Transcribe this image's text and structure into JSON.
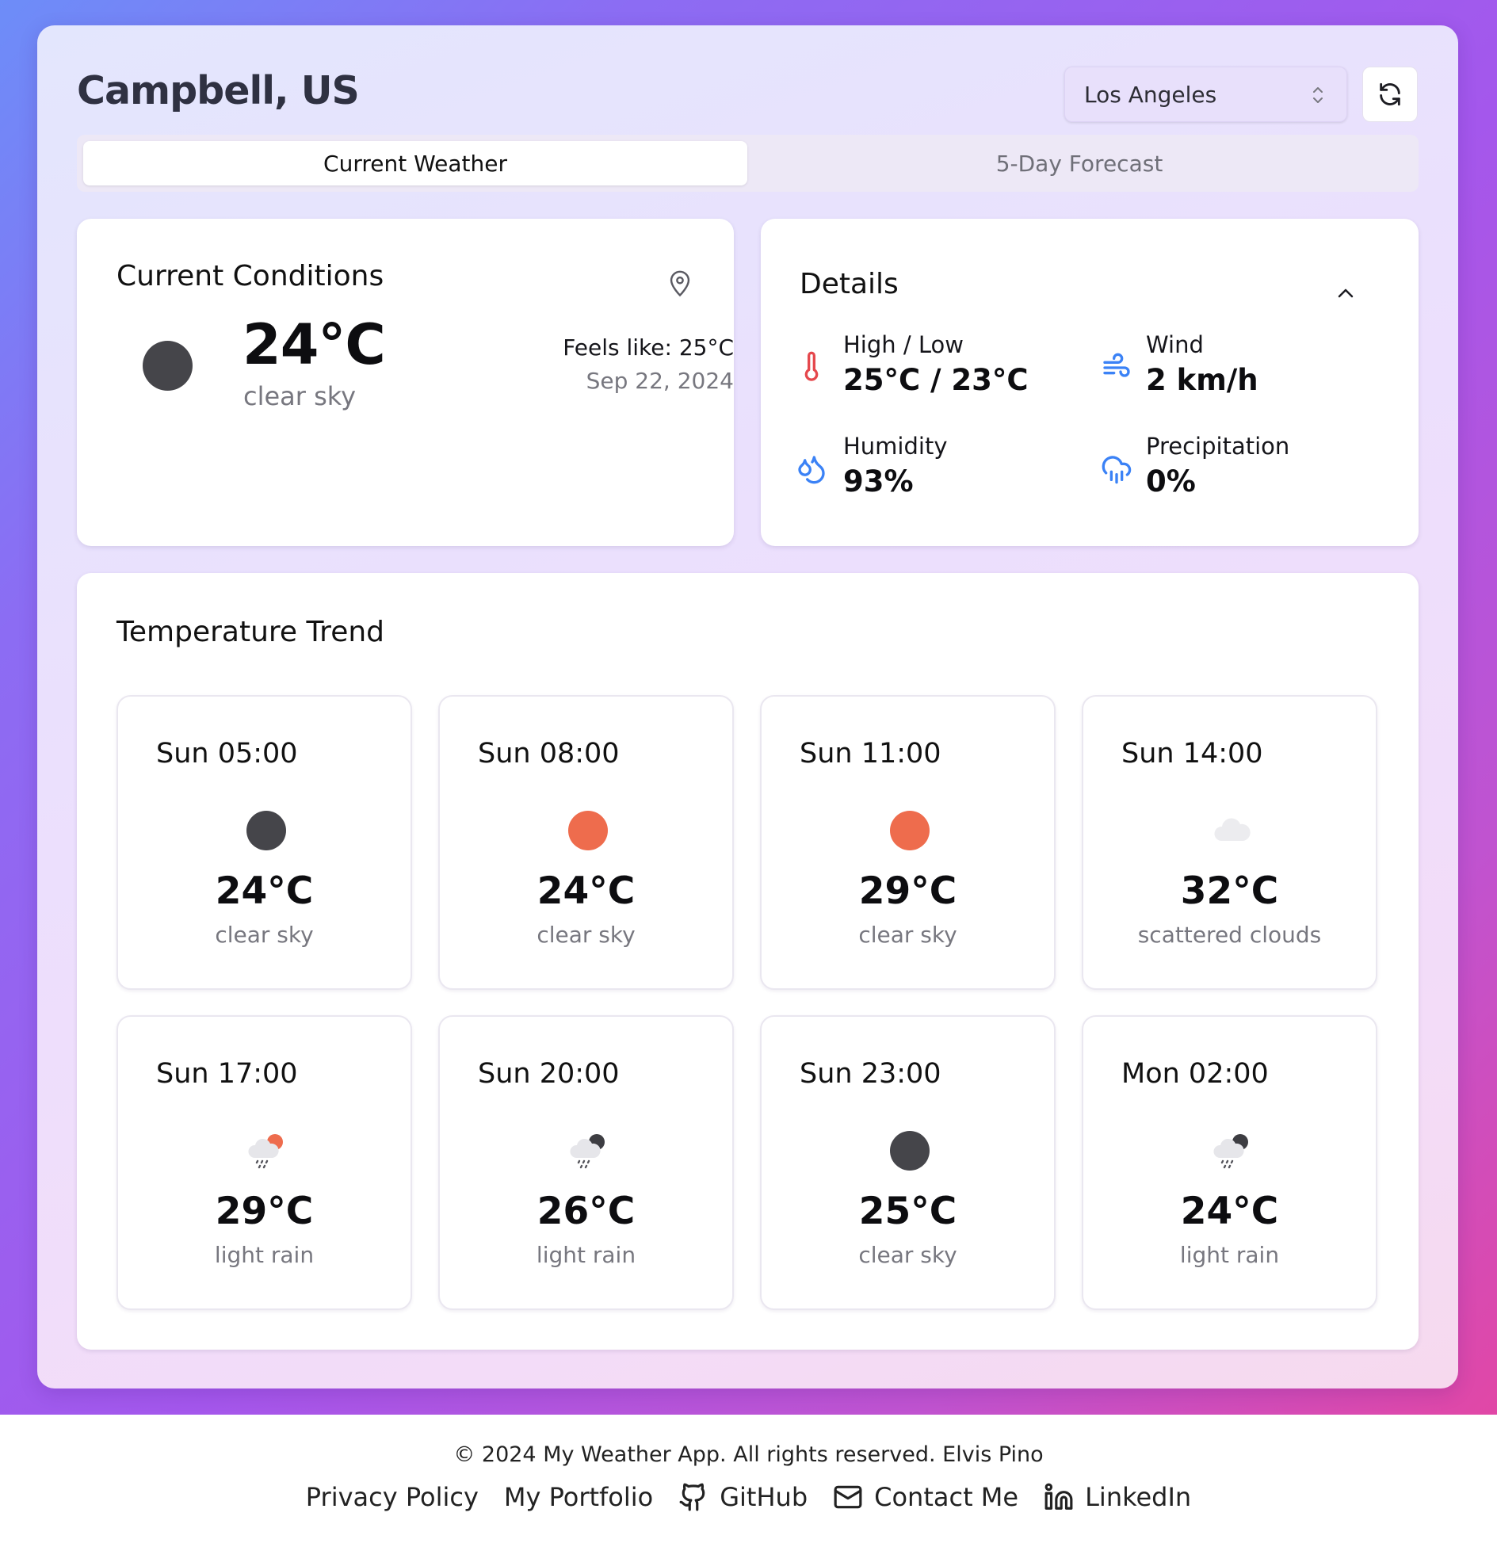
{
  "header": {
    "city_title": "Campbell, US",
    "city_select_value": "Los Angeles"
  },
  "tabs": [
    {
      "label": "Current Weather",
      "active": true
    },
    {
      "label": "5-Day Forecast",
      "active": false
    }
  ],
  "current": {
    "title": "Current Conditions",
    "temp": "24°C",
    "description": "clear sky",
    "feels_like": "Feels like: 25°C",
    "date": "Sep 22, 2024",
    "icon": "moon-icon"
  },
  "details": {
    "title": "Details",
    "items": [
      {
        "label": "High / Low",
        "value": "25°C / 23°C",
        "icon": "thermometer-icon",
        "color": "#e5484d"
      },
      {
        "label": "Wind",
        "value": "2 km/h",
        "icon": "wind-icon",
        "color": "#3b82f6"
      },
      {
        "label": "Humidity",
        "value": "93%",
        "icon": "droplets-icon",
        "color": "#3b82f6"
      },
      {
        "label": "Precipitation",
        "value": "0%",
        "icon": "cloud-rain-icon",
        "color": "#3b82f6"
      }
    ]
  },
  "trend": {
    "title": "Temperature Trend",
    "items": [
      {
        "time": "Sun 05:00",
        "temp": "24°C",
        "desc": "clear sky",
        "icon": "moon-icon"
      },
      {
        "time": "Sun 08:00",
        "temp": "24°C",
        "desc": "clear sky",
        "icon": "sun-icon"
      },
      {
        "time": "Sun 11:00",
        "temp": "29°C",
        "desc": "clear sky",
        "icon": "sun-icon"
      },
      {
        "time": "Sun 14:00",
        "temp": "32°C",
        "desc": "scattered clouds",
        "icon": "cloud-icon"
      },
      {
        "time": "Sun 17:00",
        "temp": "29°C",
        "desc": "light rain",
        "icon": "rain-sun-icon"
      },
      {
        "time": "Sun 20:00",
        "temp": "26°C",
        "desc": "light rain",
        "icon": "rain-moon-icon"
      },
      {
        "time": "Sun 23:00",
        "temp": "25°C",
        "desc": "clear sky",
        "icon": "moon-icon"
      },
      {
        "time": "Mon 02:00",
        "temp": "24°C",
        "desc": "light rain",
        "icon": "rain-moon-icon"
      }
    ]
  },
  "footer": {
    "copyright": "© 2024 My Weather App. All rights reserved. Elvis Pino",
    "links": {
      "privacy": "Privacy Policy",
      "portfolio": "My Portfolio",
      "github": "GitHub",
      "contact": "Contact Me",
      "linkedin": "LinkedIn"
    }
  },
  "colors": {
    "accent_blue": "#3b82f6",
    "accent_red": "#e5484d",
    "sun": "#ee6c4d",
    "moon": "#45454a"
  }
}
